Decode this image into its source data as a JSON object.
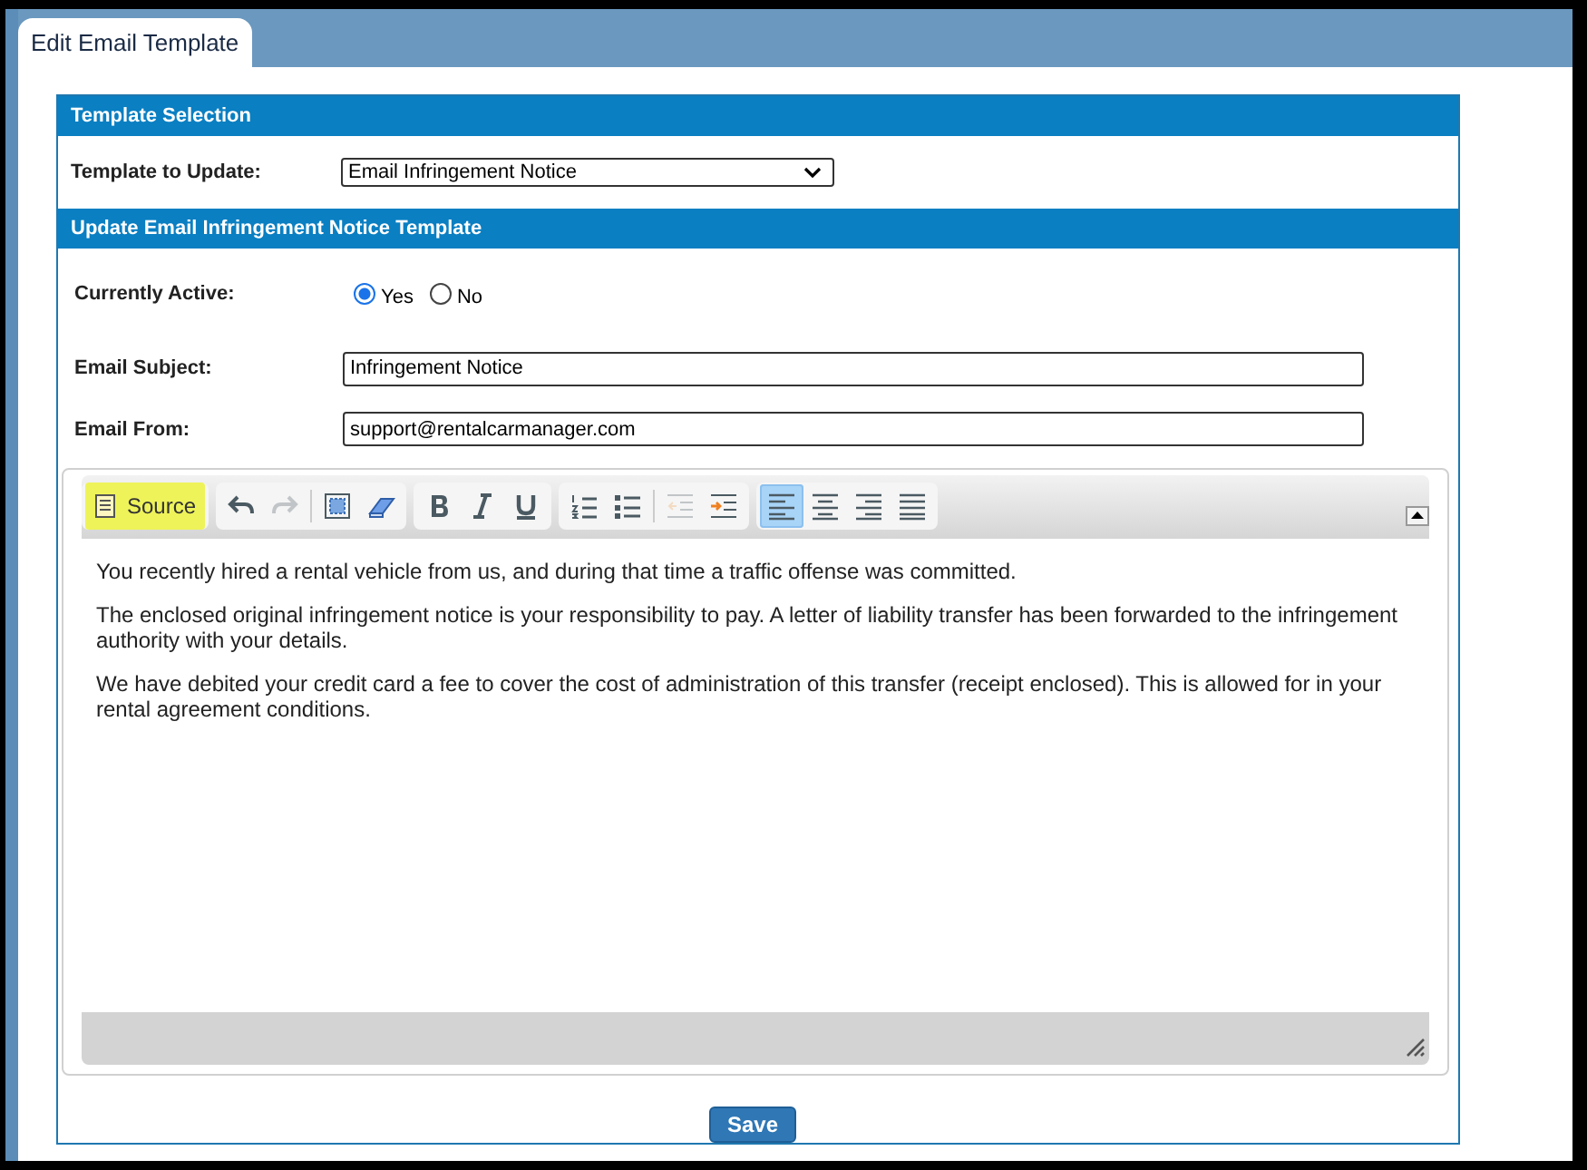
{
  "tab": {
    "label": "Edit Email Template",
    "selected": true
  },
  "template_selection": {
    "header": "Template Selection",
    "label": "Template to Update:",
    "value": "Email Infringement Notice"
  },
  "update_section": {
    "header": "Update Email Infringement Notice Template",
    "active": {
      "label": "Currently Active:",
      "options": [
        {
          "label": "Yes",
          "selected": true
        },
        {
          "label": "No",
          "selected": false
        }
      ]
    },
    "subject": {
      "label": "Email Subject:",
      "value": "Infringement Notice"
    },
    "from": {
      "label": "Email From:",
      "value": "support@rentalcarmanager.com"
    }
  },
  "editor": {
    "toolbar": [
      {
        "items": [
          {
            "kind": "source",
            "label": "Source",
            "highlighted": true
          }
        ]
      },
      {
        "items": [
          {
            "kind": "undo",
            "disabled": false,
            "on": false
          },
          {
            "kind": "redo",
            "disabled": true,
            "on": false
          },
          {
            "kind": "separator"
          },
          {
            "kind": "select-all",
            "disabled": false,
            "on": false
          },
          {
            "kind": "eraser",
            "disabled": false,
            "on": false
          }
        ]
      },
      {
        "items": [
          {
            "kind": "bold",
            "disabled": false,
            "on": false
          },
          {
            "kind": "italic",
            "disabled": false,
            "on": false
          },
          {
            "kind": "underline",
            "disabled": false,
            "on": false
          }
        ]
      },
      {
        "items": [
          {
            "kind": "numbered-list",
            "disabled": false,
            "on": false
          },
          {
            "kind": "bullet-list",
            "disabled": false,
            "on": false
          },
          {
            "kind": "separator"
          },
          {
            "kind": "outdent",
            "disabled": true,
            "on": false
          },
          {
            "kind": "indent",
            "disabled": false,
            "on": false
          }
        ]
      },
      {
        "items": [
          {
            "kind": "align-left",
            "disabled": false,
            "on": true
          },
          {
            "kind": "align-center",
            "disabled": false,
            "on": false
          },
          {
            "kind": "align-right",
            "disabled": false,
            "on": false
          },
          {
            "kind": "justify",
            "disabled": false,
            "on": false
          }
        ]
      }
    ],
    "paragraphs": [
      "You recently hired a rental vehicle from us, and during that time a traffic offense was committed.",
      "The enclosed original infringement notice is your responsibility to pay. A letter of liability transfer has been forwarded to the infringement authority with your details.",
      "We have debited your credit card a fee to cover the cost of administration of this transfer (receipt enclosed). This is allowed for in your rental agreement conditions."
    ]
  },
  "save_button": "Save"
}
